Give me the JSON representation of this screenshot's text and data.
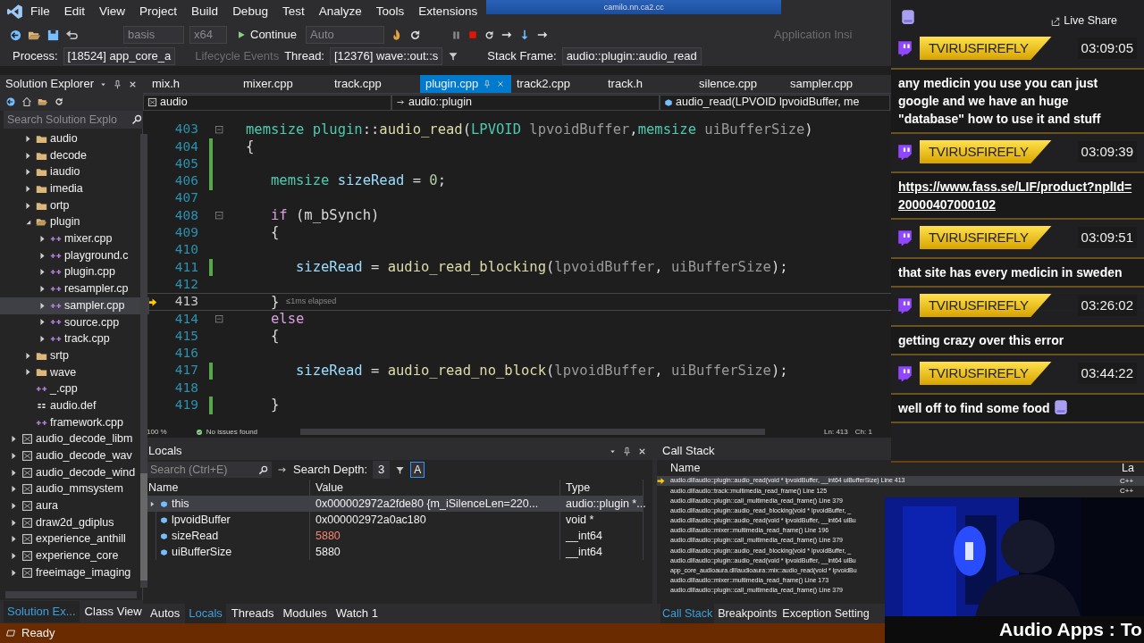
{
  "menu_bar": {
    "items": [
      "File",
      "Edit",
      "View",
      "Project",
      "Build",
      "Debug",
      "Test",
      "Analyze",
      "Tools",
      "Extensions"
    ],
    "overlapping_window_title": "camilo.nn.ca2.cc"
  },
  "toolbar": {
    "configuration": "basis",
    "platform": "x64",
    "continue_button": "Continue",
    "debug_target": "Auto",
    "application_insights": "Application Insi"
  },
  "debug_location": {
    "process_label": "Process:",
    "process": "[18524] app_core_a",
    "lifecycle_events": {
      "label": "Lifecycle Events",
      "disabled": true
    },
    "thread_label": "Thread:",
    "thread": "[12376] wave::out::s",
    "stack_frame_label": "Stack Frame:",
    "stack_frame": "audio::plugin::audio_read"
  },
  "solution_explorer": {
    "title": "Solution Explorer",
    "search": {
      "placeholder": "Search Solution Explo"
    },
    "tree": [
      {
        "children": [
          {
            "label": "audio",
            "kind": "folder",
            "expanded": false,
            "selected": false
          },
          {
            "label": "decode",
            "kind": "folder",
            "expanded": false,
            "selected": false
          },
          {
            "label": "iaudio",
            "kind": "folder",
            "expanded": false,
            "selected": false
          },
          {
            "label": "imedia",
            "kind": "folder",
            "expanded": false,
            "selected": false
          },
          {
            "label": "ortp",
            "kind": "folder",
            "expanded": false,
            "selected": false
          },
          {
            "label": "plugin",
            "kind": "folder",
            "expanded": true,
            "selected": false,
            "children": [
              {
                "label": "mixer.cpp",
                "kind": "cpp",
                "expanded": false,
                "selected": false
              },
              {
                "label": "playground.c",
                "kind": "cpp",
                "expanded": false,
                "selected": false
              },
              {
                "label": "plugin.cpp",
                "kind": "cpp",
                "expanded": false,
                "selected": false
              },
              {
                "label": "resampler.cp",
                "kind": "cpp",
                "expanded": false,
                "selected": false
              },
              {
                "label": "sampler.cpp",
                "kind": "cpp",
                "expanded": false,
                "selected": true
              },
              {
                "label": "source.cpp",
                "kind": "cpp",
                "expanded": false,
                "selected": false
              },
              {
                "label": "track.cpp",
                "kind": "cpp",
                "expanded": false,
                "selected": false
              }
            ]
          },
          {
            "label": "srtp",
            "kind": "folder",
            "expanded": false,
            "selected": false
          },
          {
            "label": "wave",
            "kind": "folder",
            "expanded": false,
            "selected": false
          },
          {
            "label": "_.cpp",
            "kind": "cpp",
            "selected": false
          },
          {
            "label": "audio.def",
            "kind": "def",
            "selected": false
          },
          {
            "label": "framework.cpp",
            "kind": "cpp",
            "selected": false
          }
        ]
      },
      {
        "label": "audio_decode_libm",
        "kind": "project",
        "expanded": false,
        "selected": false
      },
      {
        "label": "audio_decode_wav",
        "kind": "project",
        "expanded": false,
        "selected": false
      },
      {
        "label": "audio_decode_wind",
        "kind": "project",
        "expanded": false,
        "selected": false
      },
      {
        "label": "audio_mmsystem",
        "kind": "project",
        "expanded": false,
        "selected": false
      },
      {
        "label": "aura",
        "kind": "project",
        "expanded": false,
        "selected": false
      },
      {
        "label": "draw2d_gdiplus",
        "kind": "project",
        "expanded": false,
        "selected": false
      },
      {
        "label": "experience_anthill",
        "kind": "project",
        "expanded": false,
        "selected": false
      },
      {
        "label": "experience_core",
        "kind": "project",
        "expanded": false,
        "selected": false
      },
      {
        "label": "freeimage_imaging",
        "kind": "project",
        "expanded": false,
        "selected": false
      }
    ],
    "tabs": [
      {
        "label": "Solution Ex...",
        "selected": true
      },
      {
        "label": "Class View",
        "selected": false
      }
    ]
  },
  "editor": {
    "tabs": [
      {
        "label": "mix.h",
        "selected": false
      },
      {
        "label": "mixer.cpp",
        "selected": false
      },
      {
        "label": "track.cpp",
        "selected": false
      },
      {
        "label": "plugin.cpp",
        "selected": true
      },
      {
        "label": "track2.cpp",
        "selected": false
      },
      {
        "label": "track.h",
        "selected": false
      },
      {
        "label": "silence.cpp",
        "selected": false
      },
      {
        "label": "sampler.cpp",
        "selected": false
      }
    ],
    "nav": {
      "project": "audio",
      "scope": "audio::plugin",
      "member": "audio_read(LPVOID lpvoidBuffer, me"
    },
    "lines": [
      {
        "number": "403",
        "collapsible": true,
        "changed": false,
        "current": false,
        "tokens": [
          {
            "text": "memsize",
            "kind": "type"
          },
          {
            "text": " plugin",
            "kind": "type"
          },
          {
            "text": "::",
            "kind": "punct"
          },
          {
            "text": "audio_read",
            "kind": "func"
          },
          {
            "text": "(",
            "kind": "punct"
          },
          {
            "text": "LPVOID",
            "kind": "type"
          },
          {
            "text": " lpvoidBuffer",
            "kind": "param"
          },
          {
            "text": ",",
            "kind": "punct"
          },
          {
            "text": "memsize",
            "kind": "type"
          },
          {
            "text": " uiBufferSize",
            "kind": "param"
          },
          {
            "text": ")",
            "kind": "punct"
          }
        ]
      },
      {
        "number": "404",
        "collapsible": false,
        "changed": true,
        "current": false,
        "tokens": [
          {
            "text": "{",
            "kind": "punct"
          }
        ]
      },
      {
        "number": "405",
        "collapsible": false,
        "changed": true,
        "current": false
      },
      {
        "number": "406",
        "collapsible": false,
        "changed": true,
        "current": false,
        "tokens": [
          {
            "text": "   memsize",
            "kind": "type"
          },
          {
            "text": " sizeRead",
            "kind": "local"
          },
          {
            "text": " = ",
            "kind": "punct"
          },
          {
            "text": "0",
            "kind": "number"
          },
          {
            "text": ";",
            "kind": "punct"
          }
        ]
      },
      {
        "number": "407",
        "collapsible": false,
        "changed": false,
        "current": false
      },
      {
        "number": "408",
        "collapsible": true,
        "changed": false,
        "current": false,
        "tokens": [
          {
            "text": "   if",
            "kind": "keyword"
          },
          {
            "text": " (",
            "kind": "punct"
          },
          {
            "text": "m_bSynch",
            "kind": "member"
          },
          {
            "text": ")",
            "kind": "punct"
          }
        ]
      },
      {
        "number": "409",
        "collapsible": false,
        "changed": false,
        "current": false,
        "tokens": [
          {
            "text": "   {",
            "kind": "punct"
          }
        ]
      },
      {
        "number": "410",
        "collapsible": false,
        "changed": false,
        "current": false
      },
      {
        "number": "411",
        "collapsible": false,
        "changed": true,
        "current": false,
        "tokens": [
          {
            "text": "      sizeRead",
            "kind": "local"
          },
          {
            "text": " = ",
            "kind": "punct"
          },
          {
            "text": "audio_read_blocking",
            "kind": "func"
          },
          {
            "text": "(",
            "kind": "punct"
          },
          {
            "text": "lpvoidBuffer",
            "kind": "param"
          },
          {
            "text": ", ",
            "kind": "punct"
          },
          {
            "text": "uiBufferSize",
            "kind": "param"
          },
          {
            "text": ");",
            "kind": "punct"
          }
        ]
      },
      {
        "number": "412",
        "collapsible": false,
        "changed": false,
        "current": false
      },
      {
        "number": "413",
        "collapsible": false,
        "changed": false,
        "current": true,
        "hint": "≤1ms elapsed",
        "tokens": [
          {
            "text": "   }",
            "kind": "punct"
          }
        ]
      },
      {
        "number": "414",
        "collapsible": true,
        "changed": false,
        "current": false,
        "tokens": [
          {
            "text": "   else",
            "kind": "keyword"
          }
        ]
      },
      {
        "number": "415",
        "collapsible": false,
        "changed": false,
        "current": false,
        "tokens": [
          {
            "text": "   {",
            "kind": "punct"
          }
        ]
      },
      {
        "number": "416",
        "collapsible": false,
        "changed": false,
        "current": false
      },
      {
        "number": "417",
        "collapsible": false,
        "changed": true,
        "current": false,
        "tokens": [
          {
            "text": "      sizeRead",
            "kind": "local"
          },
          {
            "text": " = ",
            "kind": "punct"
          },
          {
            "text": "audio_read_no_block",
            "kind": "func"
          },
          {
            "text": "(",
            "kind": "punct"
          },
          {
            "text": "lpvoidBuffer",
            "kind": "param"
          },
          {
            "text": ", ",
            "kind": "punct"
          },
          {
            "text": "uiBufferSize",
            "kind": "param"
          },
          {
            "text": ");",
            "kind": "punct"
          }
        ]
      },
      {
        "number": "418",
        "collapsible": false,
        "changed": false,
        "current": false
      },
      {
        "number": "419",
        "collapsible": false,
        "changed": true,
        "current": false,
        "tokens": [
          {
            "text": "   }",
            "kind": "punct"
          }
        ]
      }
    ],
    "status": {
      "zoom": "100 %",
      "issues": "No issues found",
      "line": "Ln: 413",
      "column": "Ch: 1"
    }
  },
  "locals": {
    "title": "Locals",
    "search": {
      "placeholder": "Search (Ctrl+E)"
    },
    "depth_label": "Search Depth:",
    "depth": "3",
    "case_toggle": "A",
    "columns": [
      "Name",
      "Value",
      "Type"
    ],
    "rows": [
      {
        "name": "this",
        "value": "0x000002972a2fde80 {m_iSilenceLen=220...",
        "type": "audio::plugin *...",
        "expanded": false,
        "changed": false,
        "selected": true
      },
      {
        "name": "lpvoidBuffer",
        "value": "0x000002972a0ac180",
        "type": "void *",
        "changed": false,
        "selected": false
      },
      {
        "name": "sizeRead",
        "value": "5880",
        "type": "__int64",
        "changed": true,
        "selected": false
      },
      {
        "name": "uiBufferSize",
        "value": "5880",
        "type": "__int64",
        "changed": false,
        "selected": false
      }
    ],
    "tabs": [
      {
        "label": "Autos",
        "selected": false
      },
      {
        "label": "Locals",
        "selected": true
      },
      {
        "label": "Threads",
        "selected": false
      },
      {
        "label": "Modules",
        "selected": false
      },
      {
        "label": "Watch 1",
        "selected": false
      }
    ]
  },
  "call_stack": {
    "title": "Call Stack",
    "columns": [
      "Name",
      "La"
    ],
    "rows": [
      {
        "name": "audio.dll!audio::plugin::audio_read(void * lpvoidBuffer, __int64 uiBufferSize) Line 413",
        "language": "C++",
        "current": true
      },
      {
        "name": "audio.dll!audio::track::multimedia_read_frame() Line 125",
        "language": "C++",
        "current": false
      },
      {
        "name": "audio.dll!audio::plugin::call_multimedia_read_frame() Line 379",
        "current": false
      },
      {
        "name": "audio.dll!audio::plugin::audio_read_blocking(void * lpvoidBuffer, _",
        "current": false
      },
      {
        "name": "audio.dll!audio::plugin::audio_read(void * lpvoidBuffer, __int64 uiBu",
        "current": false
      },
      {
        "name": "audio.dll!audio::mixer::multimedia_read_frame() Line 196",
        "current": false
      },
      {
        "name": "audio.dll!audio::plugin::call_multimedia_read_frame() Line 379",
        "current": false
      },
      {
        "name": "audio.dll!audio::plugin::audio_read_blocking(void * lpvoidBuffer, _",
        "current": false
      },
      {
        "name": "audio.dll!audio::plugin::audio_read(void * lpvoidBuffer, __int64 uiBu",
        "current": false
      },
      {
        "name": "app_core_audioaura.dll!audioaura::mix::audio_read(void * lpvoidBu",
        "current": false
      },
      {
        "name": "audio.dll!audio::mixer::multimedia_read_frame() Line 173",
        "current": false
      },
      {
        "name": "audio.dll!audio::plugin::call_multimedia_read_frame() Line 379",
        "current": false
      }
    ],
    "tabs": [
      {
        "label": "Call Stack",
        "selected": true
      },
      {
        "label": "Breakpoints",
        "selected": false
      },
      {
        "label": "Exception Setting",
        "selected": false
      }
    ]
  },
  "status_bar": {
    "text": "Ready"
  },
  "chat": {
    "live_share": "Live Share",
    "messages": [
      {
        "user": "TVIRUSFIREFLY",
        "time": "03:09:05",
        "kind": "text",
        "text": "any medicin you use you can just google and we have an huge \"database\" how to use it and stuff"
      },
      {
        "user": "TVIRUSFIREFLY",
        "time": "03:09:39",
        "kind": "link",
        "text": "https://www.fass.se/LIF/product?nplId=20000407000102"
      },
      {
        "user": "TVIRUSFIREFLY",
        "time": "03:09:51",
        "kind": "text",
        "text": "that site has every medicin in sweden"
      },
      {
        "user": "TVIRUSFIREFLY",
        "time": "03:26:02",
        "kind": "text",
        "text": "getting crazy over this error"
      },
      {
        "user": "TVIRUSFIREFLY",
        "time": "03:44:22",
        "kind": "text",
        "text": "well off to find some food",
        "emote": true
      }
    ]
  },
  "stream_title": "Audio Apps : To"
}
